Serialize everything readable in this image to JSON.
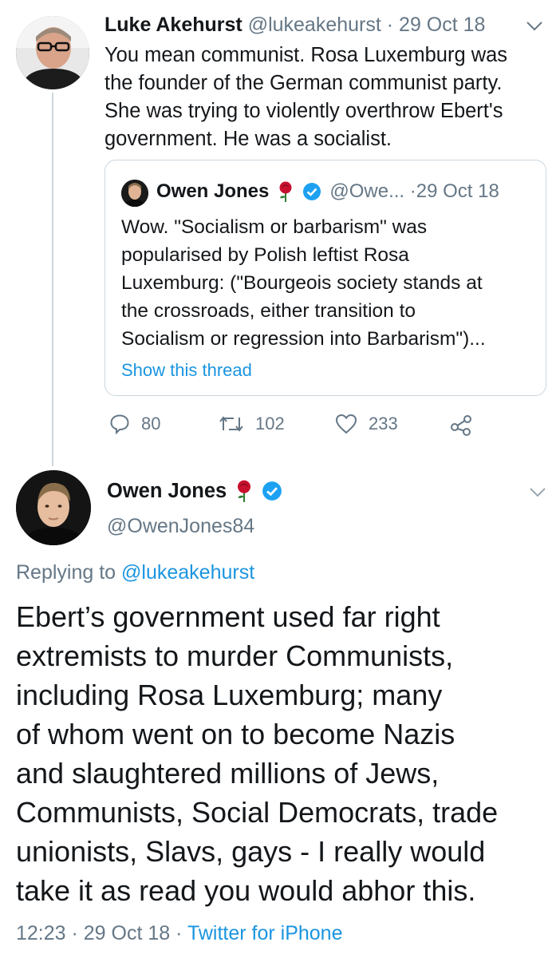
{
  "tweet1": {
    "display_name": "Luke Akehurst",
    "handle": "@lukeakehurst",
    "date": "29 Oct 18",
    "text_lines": [
      "You mean communist. Rosa Luxemburg was",
      "the founder of the German communist party.",
      "She was trying to violently overthrow Ebert's",
      "government. He was a socialist."
    ],
    "quoted": {
      "display_name": "Owen Jones",
      "handle": "@Owe...",
      "date": "29 Oct 18",
      "text_lines": [
        "Wow. \"Socialism or barbarism\" was",
        "popularised by Polish leftist Rosa",
        "Luxemburg: (\"Bourgeois society stands at",
        "the crossroads, either transition to",
        "Socialism or regression into Barbarism\")..."
      ],
      "show_thread": "Show this thread"
    },
    "actions": {
      "replies": "80",
      "retweets": "102",
      "likes": "233"
    }
  },
  "tweet2": {
    "display_name": "Owen Jones",
    "handle": "@OwenJones84",
    "replying_prefix": "Replying to",
    "replying_to": "@lukeakehurst",
    "text_lines": [
      "Ebert’s government used far right",
      "extremists to murder Communists,",
      "including Rosa Luxemburg; many",
      "of whom went on to become Nazis",
      "and slaughtered millions of Jews,",
      "Communists, Social Democrats, trade",
      "unionists, Slavs, gays - I really would",
      "take it as read you would abhor this."
    ],
    "time": "12:23",
    "date": "29 Oct 18",
    "source": "Twitter for iPhone"
  },
  "colors": {
    "accent": "#1b95e0",
    "muted": "#657786",
    "verified": "#1da1f2",
    "rose": "#c8102e"
  },
  "icons": [
    "chevron-down-icon",
    "verified-icon",
    "rose-icon",
    "reply-icon",
    "retweet-icon",
    "like-icon",
    "share-icon"
  ]
}
